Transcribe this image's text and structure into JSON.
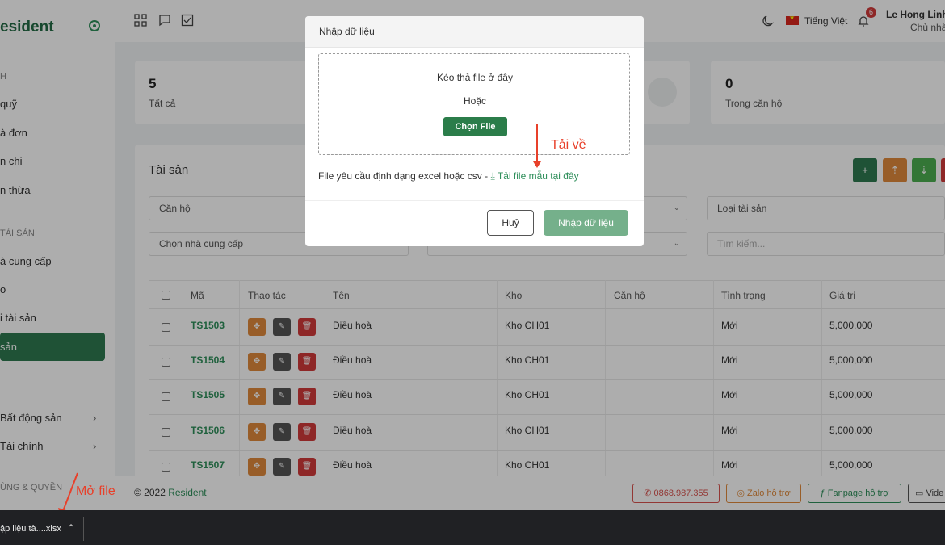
{
  "sidebar": {
    "brand": "esident",
    "section_top": "H",
    "items_top": [
      "quỹ",
      "à đơn",
      "n chi",
      "n thừa"
    ],
    "section_assets": "TÀI SẢN",
    "items_assets": [
      "à cung cấp",
      "o",
      "i tài sản"
    ],
    "active_item": "sản",
    "items_groups": [
      "Bất động sản",
      "Tài chính"
    ],
    "section_bottom": "ÙNG & QUYỀN"
  },
  "topbar": {
    "language": "Tiếng Việt",
    "notif_count": "6",
    "user_name": "Le Hong Linh",
    "user_role": "Chủ nhà"
  },
  "stats": [
    {
      "value": "5",
      "label": "Tất cả"
    },
    {
      "value": "0",
      "label": "Trong căn hộ"
    }
  ],
  "assets": {
    "title": "Tài sản",
    "filters": {
      "apartment": "Căn hộ",
      "asset_type": "Loại tài sản",
      "supplier": "Chọn nhà cung cấp",
      "search_placeholder": "Tìm kiếm..."
    },
    "columns": [
      "Mã",
      "Thao tác",
      "Tên",
      "Kho",
      "Căn hộ",
      "Tình trạng",
      "Giá trị"
    ],
    "rows": [
      {
        "code": "TS1503",
        "name": "Điều hoà",
        "warehouse": "Kho CH01",
        "apartment": "",
        "status": "Mới",
        "value": "5,000,000"
      },
      {
        "code": "TS1504",
        "name": "Điều hoà",
        "warehouse": "Kho CH01",
        "apartment": "",
        "status": "Mới",
        "value": "5,000,000"
      },
      {
        "code": "TS1505",
        "name": "Điều hoà",
        "warehouse": "Kho CH01",
        "apartment": "",
        "status": "Mới",
        "value": "5,000,000"
      },
      {
        "code": "TS1506",
        "name": "Điều hoà",
        "warehouse": "Kho CH01",
        "apartment": "",
        "status": "Mới",
        "value": "5,000,000"
      },
      {
        "code": "TS1507",
        "name": "Điều hoà",
        "warehouse": "Kho CH01",
        "apartment": "",
        "status": "Mới",
        "value": "5,000,000"
      }
    ]
  },
  "footer": {
    "copyright": "© 2022",
    "brand": "Resident",
    "phone": "0868.987.355",
    "zalo": "Zalo hỗ trợ",
    "fanpage": "Fanpage hỗ trợ",
    "video": "Vide"
  },
  "modal": {
    "title": "Nhập dữ liệu",
    "drop_text": "Kéo thả file ở đây",
    "or_text": "Hoặc",
    "choose_label": "Chọn File",
    "requirement": "File yêu cầu định dạng excel hoặc csv -",
    "template_link": "Tải file mẫu tại đây",
    "cancel_label": "Huỷ",
    "submit_label": "Nhập dữ liệu"
  },
  "annotations": {
    "download": "Tải về",
    "open_file": "Mở file"
  },
  "download_bar": {
    "filename": "ập liệu tà....xlsx"
  },
  "colors": {
    "primary": "#2f7a50",
    "accent_red": "#e8402a",
    "orange": "#e08a3c",
    "danger": "#d23a3a"
  }
}
